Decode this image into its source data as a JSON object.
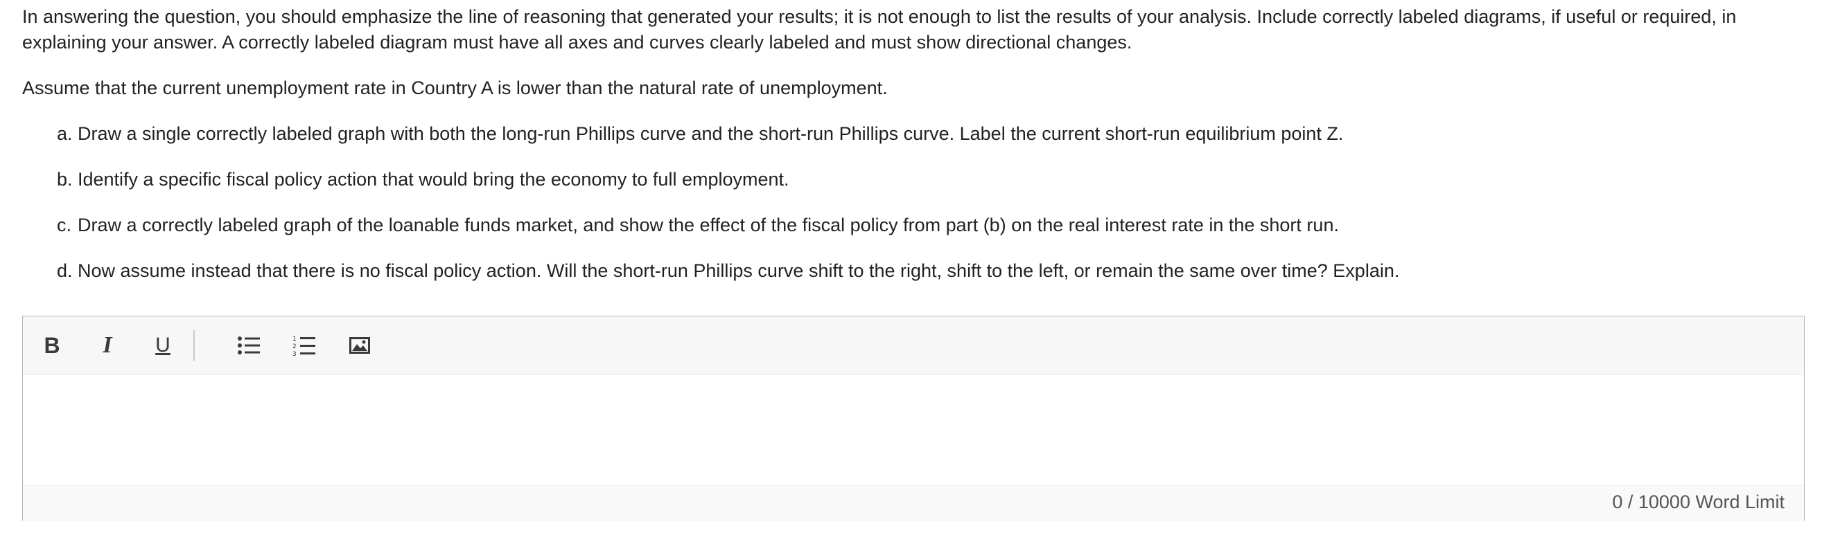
{
  "question": {
    "intro": "In answering the question, you should emphasize the line of reasoning that generated your results; it is not enough to list the results of your analysis. Include correctly labeled diagrams, if useful or required, in explaining your answer. A correctly labeled diagram must have all axes and curves clearly labeled and must show directional changes.",
    "assumption": "Assume that the current unemployment rate in Country A is lower than the natural rate of unemployment.",
    "parts": [
      {
        "letter": "a.",
        "text": "Draw a single correctly labeled graph with both the long-run Phillips curve and the short-run Phillips curve. Label the current short-run equilibrium point Z."
      },
      {
        "letter": "b.",
        "text": "Identify a specific fiscal policy action that would bring the economy to full employment."
      },
      {
        "letter": "c.",
        "text": "Draw a correctly labeled graph of the loanable funds market, and show the effect of the fiscal policy from part (b) on the real interest rate in the short run."
      },
      {
        "letter": "d.",
        "text": "Now assume instead that there is no fiscal policy action. Will the short-run Phillips curve shift to the right, shift to the left, or remain the same over time? Explain."
      }
    ]
  },
  "editor": {
    "toolbar": {
      "bold_label": "B",
      "italic_label": "I",
      "underline_label": "U",
      "icons": [
        "bulleted-list-icon",
        "numbered-list-icon",
        "insert-image-icon"
      ]
    },
    "body_value": "",
    "word_count": "0 / 10000 Word Limit"
  }
}
